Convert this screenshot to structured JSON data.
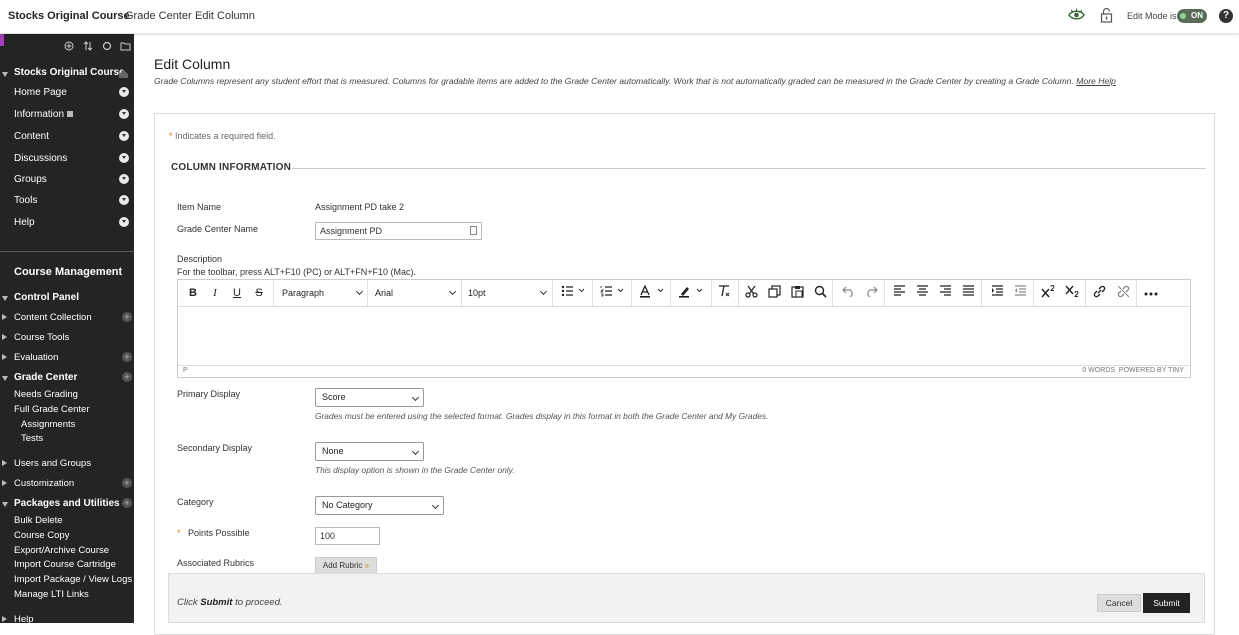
{
  "topbar": {
    "course_title": "Stocks Original Course",
    "crumb_grade_center": "Grade Center",
    "crumb_edit_column": "Edit Column",
    "edit_mode_label": "Edit Mode is:",
    "edit_mode_value": "ON",
    "help_glyph": "?"
  },
  "sidebar": {
    "course_title": "Stocks Original Course",
    "menu_items": [
      "Home Page",
      "Information",
      "Content",
      "Discussions",
      "Groups",
      "Tools",
      "Help"
    ],
    "course_management_title": "Course Management",
    "control_panel": "Control Panel",
    "content_collection": "Content Collection",
    "course_tools": "Course Tools",
    "evaluation": "Evaluation",
    "grade_center": "Grade Center",
    "needs_grading": "Needs Grading",
    "full_grade_center": "Full Grade Center",
    "assignments": "Assignments",
    "tests": "Tests",
    "users_and_groups": "Users and Groups",
    "customization": "Customization",
    "packages_and_utilities": "Packages and Utilities",
    "bulk_delete": "Bulk Delete",
    "course_copy": "Course Copy",
    "export_archive": "Export/Archive Course",
    "import_cartridge": "Import Course Cartridge",
    "import_package": "Import Package / View Logs",
    "manage_lti": "Manage LTI Links",
    "help_bottom": "Help"
  },
  "page": {
    "title": "Edit Column",
    "description": "Grade Columns represent any student effort that is measured. Columns for gradable items are added to the Grade Center automatically. Work that is not automatically graded can be measured in the Grade Center by creating a Grade Column.",
    "more_help": "More Help"
  },
  "form": {
    "required_note": "Indicates a required field.",
    "required_star": "*",
    "section_title": "COLUMN INFORMATION",
    "item_name_label": "Item Name",
    "item_name_value": "Assignment PD take 2",
    "gc_name_label": "Grade Center Name",
    "gc_name_value": "Assignment PD",
    "description_label": "Description",
    "toolbar_hint": "For the toolbar, press ALT+F10 (PC) or ALT+FN+F10 (Mac).",
    "editor": {
      "paragraph": "Paragraph",
      "font": "Arial",
      "size": "10pt",
      "status_path": "P",
      "word_count": "0 WORDS",
      "powered_by": "POWERED BY TINY"
    },
    "primary_display_label": "Primary Display",
    "primary_display_value": "Score",
    "primary_display_hint": "Grades must be entered using the selected format. Grades display in this format in both the Grade Center and My Grades.",
    "secondary_display_label": "Secondary Display",
    "secondary_display_value": "None",
    "secondary_display_hint": "This display option is shown in the Grade Center only.",
    "category_label": "Category",
    "category_value": "No Category",
    "points_label": "Points Possible",
    "points_value": "100",
    "rubrics_label": "Associated Rubrics",
    "add_rubric": "Add Rubric"
  },
  "footer": {
    "msg_pre": "Click",
    "msg_bold": "Submit",
    "msg_post": "to proceed.",
    "cancel": "Cancel",
    "submit": "Submit"
  },
  "colors": {
    "sidebar_bg": "#242424",
    "accent": "#a53fb8",
    "submit_bg": "#222222",
    "required_star": "#e07b00"
  }
}
